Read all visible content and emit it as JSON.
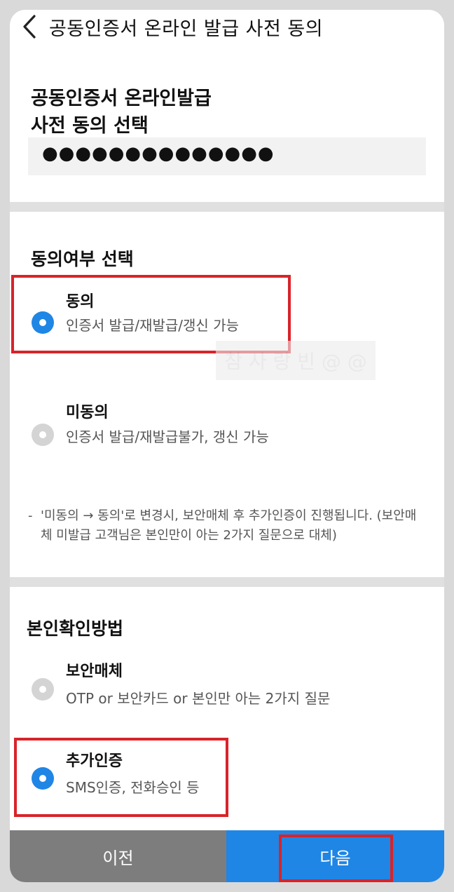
{
  "header": {
    "title": "공동인증서 온라인 발급 사전 동의"
  },
  "intro": {
    "title_line1": "공동인증서 온라인발급",
    "title_line2": "사전 동의 선택",
    "masked_value": "●●●●●●●●●●●●●●"
  },
  "consent": {
    "title": "동의여부 선택",
    "options": [
      {
        "label": "동의",
        "description": "인증서 발급/재발급/갱신 가능",
        "selected": true
      },
      {
        "label": "미동의",
        "description": "인증서 발급/재발급불가, 갱신 가능",
        "selected": false
      }
    ],
    "note_dash": "-",
    "note": "'미동의 → 동의'로 변경시, 보안매체 후 추가인증이 진행됩니다. (보안매체 미발급 고객님은 본인만이 아는 2가지 질문으로 대체)",
    "watermark": "참 사 랑 빈 @ @"
  },
  "identity": {
    "title": "본인확인방법",
    "options": [
      {
        "label": "보안매체",
        "description": "OTP or 보안카드 or 본인만 아는 2가지 질문",
        "selected": false
      },
      {
        "label": "추가인증",
        "description": "SMS인증, 전화승인 등",
        "selected": true
      }
    ]
  },
  "footer": {
    "prev_label": "이전",
    "next_label": "다음"
  },
  "colors": {
    "accent": "#1f86e5",
    "highlight": "#d8232a",
    "inactive": "#d4d4d4",
    "prev_button": "#7d7d7d"
  }
}
